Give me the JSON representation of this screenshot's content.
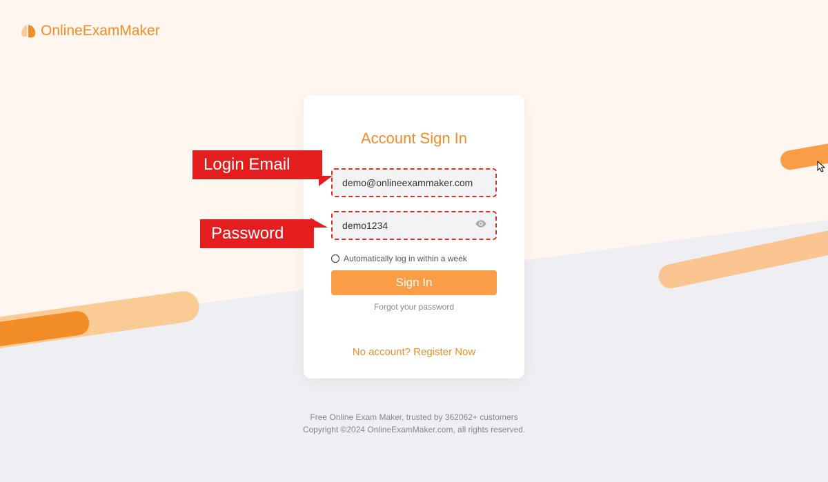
{
  "brand": {
    "name": "OnlineExamMaker"
  },
  "card": {
    "title": "Account Sign In",
    "email_value": "demo@onlineexammaker.com",
    "password_value": "demo1234",
    "auto_login_label": "Automatically log in within a week",
    "signin_label": "Sign In",
    "forgot_label": "Forgot your password",
    "register_label": "No account? Register Now"
  },
  "annotations": {
    "email": "Login Email",
    "password": "Password"
  },
  "footer": {
    "line1": "Free Online Exam Maker, trusted by 362062+ customers",
    "line2": "Copyright ©2024 OnlineExamMaker.com, all rights reserved."
  }
}
